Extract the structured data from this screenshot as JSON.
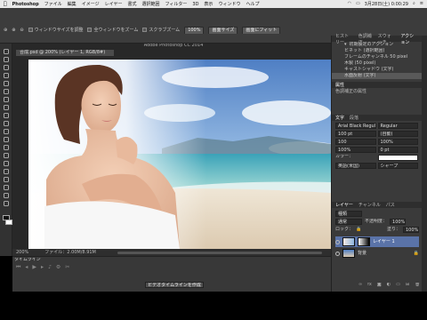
{
  "menubar": {
    "apple": "",
    "items": [
      "Photoshop",
      "ファイル",
      "編集",
      "イメージ",
      "レイヤー",
      "書式",
      "選択範囲",
      "フィルター",
      "3D",
      "表示",
      "ウィンドウ",
      "ヘルプ"
    ],
    "clock": "3月28日(土) 0:00:29"
  },
  "options": {
    "items": [
      "ウィンドウサイズを調整",
      "全ウィンドウをズーム",
      "スクラブズーム"
    ],
    "zoom_value": "100%",
    "buttons": [
      "画面サイズ",
      "画面にフィット"
    ]
  },
  "app_title": "Adobe Photoshop CC 2014",
  "document": {
    "tab": "合成.psd @ 200% (レイヤー 1, RGB/8#)",
    "status_zoom": "200%",
    "status_file": "ファイル：2.00M/8.91M"
  },
  "timeline": {
    "title": "タイムライン",
    "create_button": "ビデオタイムラインを作成"
  },
  "history": {
    "tabs": [
      "ヒストリー",
      "色調補正",
      "スウォッチ",
      "アクション"
    ],
    "rows": [
      "初期設定のアクション",
      "ビネット (選択範囲)",
      "フレームのチャンネル 50 pixel",
      "木製 (50 pixel)",
      "キャストシャドウ (文字)",
      "水面反射 (文字)"
    ]
  },
  "properties": {
    "title": "属性",
    "subtitle": "色調補正の属性"
  },
  "character": {
    "tabs": [
      "文字",
      "段落"
    ],
    "font": "Arial Black Regular",
    "style": "Regular",
    "size": "100 pt",
    "leading": "(自動)",
    "tracking": "100",
    "scale_v": "100%",
    "scale_h": "100%",
    "baseline": "0 pt",
    "color_label": "カラー：",
    "lang": "英語(米国)",
    "aa": "シャープ"
  },
  "layers": {
    "tabs": [
      "レイヤー",
      "チャンネル",
      "パス"
    ],
    "kind": "種類",
    "mode": "通常",
    "opacity_label": "不透明度：",
    "opacity": "100%",
    "fill_label": "塗り：",
    "fill": "100%",
    "lock_label": "ロック：",
    "rows": [
      "レイヤー 1",
      "背景"
    ]
  }
}
